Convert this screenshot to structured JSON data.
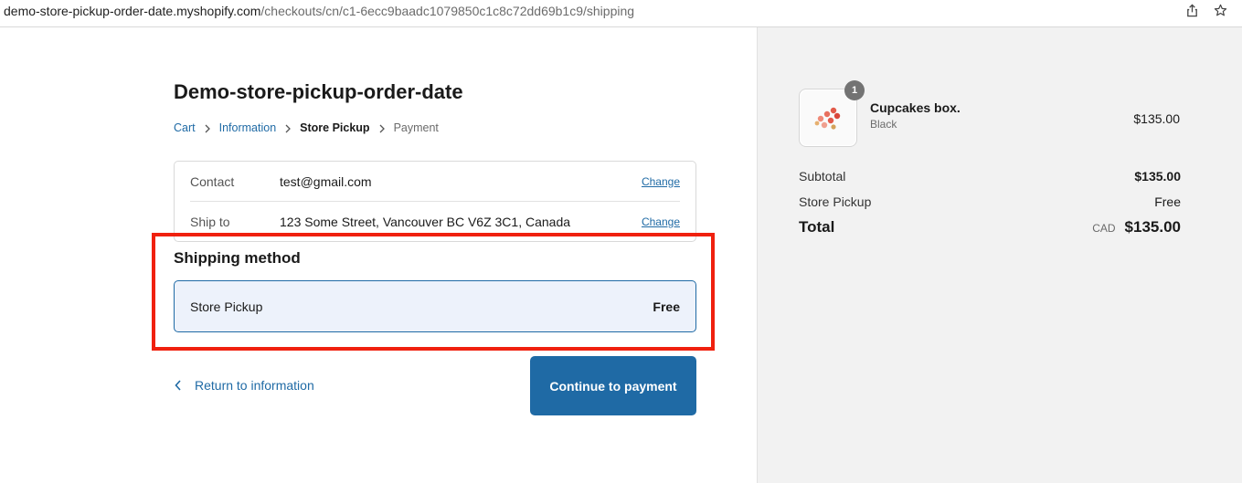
{
  "browser": {
    "url_host": "demo-store-pickup-order-date.myshopify.com",
    "url_path": "/checkouts/cn/c1-6ecc9baadc1079850c1c8c72dd69b1c9/shipping",
    "icons": [
      "share-icon",
      "star-icon"
    ]
  },
  "store": {
    "title": "Demo-store-pickup-order-date"
  },
  "breadcrumb": {
    "items": [
      {
        "label": "Cart",
        "state": "link"
      },
      {
        "label": "Information",
        "state": "link"
      },
      {
        "label": "Store Pickup",
        "state": "current"
      },
      {
        "label": "Payment",
        "state": "future"
      }
    ]
  },
  "review": {
    "contact": {
      "label": "Contact",
      "value": "test@gmail.com",
      "action": "Change"
    },
    "ship_to": {
      "label": "Ship to",
      "value": "123 Some Street, Vancouver BC V6Z 3C1, Canada",
      "action": "Change"
    }
  },
  "shipping_method": {
    "heading": "Shipping method",
    "option": {
      "name": "Store Pickup",
      "price": "Free"
    }
  },
  "actions": {
    "return_label": "Return to information",
    "continue_label": "Continue to payment"
  },
  "summary": {
    "item": {
      "quantity": "1",
      "name": "Cupcakes box.",
      "variant": "Black",
      "price": "$135.00"
    },
    "subtotal_label": "Subtotal",
    "subtotal_value": "$135.00",
    "shipping_label": "Store Pickup",
    "shipping_value": "Free",
    "total_label": "Total",
    "currency": "CAD",
    "total_value": "$135.00"
  },
  "colors": {
    "accent": "#1f6aa5",
    "highlight": "#f0200e",
    "sidebar_bg": "#f2f2f2"
  }
}
